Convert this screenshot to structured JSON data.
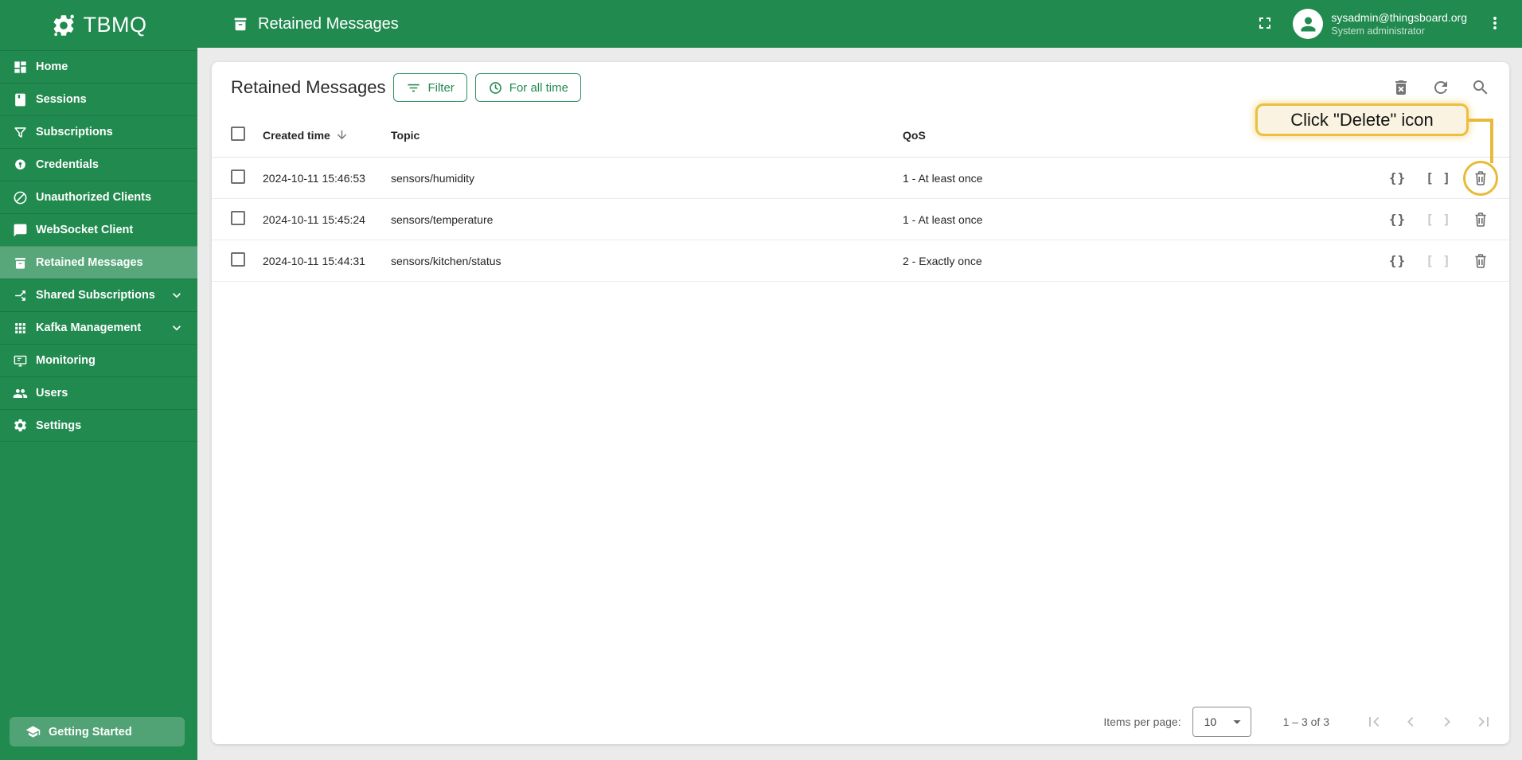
{
  "app": {
    "name": "TBMQ"
  },
  "sidebar": {
    "items": [
      {
        "label": "Home",
        "icon": "dashboard-icon",
        "active": false,
        "expandable": false
      },
      {
        "label": "Sessions",
        "icon": "book-icon",
        "active": false,
        "expandable": false
      },
      {
        "label": "Subscriptions",
        "icon": "funnel-icon",
        "active": false,
        "expandable": false
      },
      {
        "label": "Credentials",
        "icon": "credentials-icon",
        "active": false,
        "expandable": false
      },
      {
        "label": "Unauthorized Clients",
        "icon": "block-icon",
        "active": false,
        "expandable": false
      },
      {
        "label": "WebSocket Client",
        "icon": "chat-icon",
        "active": false,
        "expandable": false
      },
      {
        "label": "Retained Messages",
        "icon": "archive-icon",
        "active": true,
        "expandable": false
      },
      {
        "label": "Shared Subscriptions",
        "icon": "split-icon",
        "active": false,
        "expandable": true
      },
      {
        "label": "Kafka Management",
        "icon": "grid-icon",
        "active": false,
        "expandable": true
      },
      {
        "label": "Monitoring",
        "icon": "monitor-icon",
        "active": false,
        "expandable": false
      },
      {
        "label": "Users",
        "icon": "people-icon",
        "active": false,
        "expandable": false
      },
      {
        "label": "Settings",
        "icon": "gear-icon",
        "active": false,
        "expandable": false
      }
    ],
    "getting_started_label": "Getting Started"
  },
  "topbar": {
    "title": "Retained Messages",
    "title_icon": "archive-icon",
    "user_email": "sysadmin@thingsboard.org",
    "user_role": "System administrator"
  },
  "toolbar": {
    "page_title": "Retained Messages",
    "filter_label": "Filter",
    "time_range_label": "For all time",
    "icons": [
      "delete-all-icon",
      "refresh-icon",
      "search-icon"
    ]
  },
  "table": {
    "headers": {
      "created_time": "Created time",
      "topic": "Topic",
      "qos": "QoS"
    },
    "rows": [
      {
        "created_time": "2024-10-11 15:46:53",
        "topic": "sensors/humidity",
        "qos": "1 - At least once",
        "payload_enabled": true,
        "props_enabled": true
      },
      {
        "created_time": "2024-10-11 15:45:24",
        "topic": "sensors/temperature",
        "qos": "1 - At least once",
        "payload_enabled": true,
        "props_enabled": false
      },
      {
        "created_time": "2024-10-11 15:44:31",
        "topic": "sensors/kitchen/status",
        "qos": "2 - Exactly once",
        "payload_enabled": true,
        "props_enabled": false
      }
    ],
    "row_action_icons": [
      "json-braces-icon",
      "square-brackets-icon",
      "delete-icon"
    ]
  },
  "annotation": {
    "label": "Click \"Delete\" icon",
    "target_row": 0
  },
  "paginator": {
    "items_per_page_label": "Items per page:",
    "page_size": "10",
    "range_label": "1 – 3 of 3"
  },
  "colors": {
    "primary_green": "#218a4f",
    "sidebar_active": "rgba(255,255,255,0.25)",
    "accent_gold": "#e9ba3a",
    "tooltip_bg": "#faf3e1",
    "icon_gray": "#757575",
    "disabled_gray": "#c9c9c9",
    "background_gray": "#ebebeb"
  }
}
